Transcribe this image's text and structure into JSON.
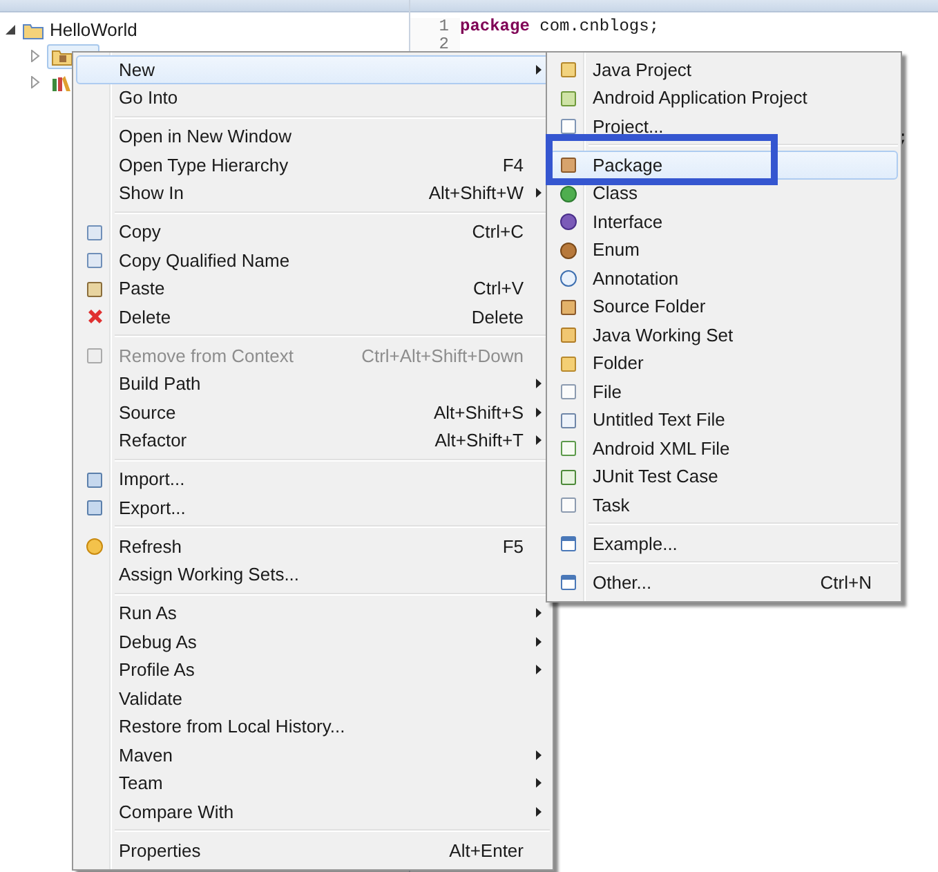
{
  "package_explorer": {
    "tree": [
      {
        "label": "HelloWorld",
        "expanded": true,
        "children": [
          {
            "kind": "package-folder",
            "selected": true
          },
          {
            "kind": "library",
            "selected": false
          }
        ]
      }
    ]
  },
  "editor": {
    "lines": [
      {
        "number": "1",
        "keyword": "package",
        "code": "com.cnblogs;"
      },
      {
        "number": "2"
      }
    ],
    "covered_line_end": ";"
  },
  "context_menu": {
    "items": [
      {
        "kind": "item",
        "label": "New",
        "submenu": true,
        "highlighted": true,
        "disabled": false
      },
      {
        "kind": "item",
        "label": "Go Into",
        "submenu": false,
        "highlighted": false,
        "disabled": false
      },
      {
        "kind": "separator"
      },
      {
        "kind": "item",
        "label": "Open in New Window",
        "submenu": false,
        "highlighted": false,
        "disabled": false
      },
      {
        "kind": "item",
        "label": "Open Type Hierarchy",
        "shortcut": "F4",
        "submenu": false,
        "highlighted": false,
        "disabled": false
      },
      {
        "kind": "item",
        "label": "Show In",
        "shortcut": "Alt+Shift+W",
        "submenu": true,
        "highlighted": false,
        "disabled": false
      },
      {
        "kind": "separator"
      },
      {
        "kind": "item",
        "label": "Copy",
        "shortcut": "Ctrl+C",
        "submenu": false,
        "highlighted": false,
        "disabled": false
      },
      {
        "kind": "item",
        "label": "Copy Qualified Name",
        "submenu": false,
        "highlighted": false,
        "disabled": false
      },
      {
        "kind": "item",
        "label": "Paste",
        "shortcut": "Ctrl+V",
        "submenu": false,
        "highlighted": false,
        "disabled": false
      },
      {
        "kind": "item",
        "label": "Delete",
        "shortcut": "Delete",
        "submenu": false,
        "highlighted": false,
        "disabled": false
      },
      {
        "kind": "separator"
      },
      {
        "kind": "item",
        "label": "Remove from Context",
        "shortcut": "Ctrl+Alt+Shift+Down",
        "submenu": false,
        "highlighted": false,
        "disabled": true
      },
      {
        "kind": "item",
        "label": "Build Path",
        "submenu": true,
        "highlighted": false,
        "disabled": false
      },
      {
        "kind": "item",
        "label": "Source",
        "shortcut": "Alt+Shift+S",
        "submenu": true,
        "highlighted": false,
        "disabled": false
      },
      {
        "kind": "item",
        "label": "Refactor",
        "shortcut": "Alt+Shift+T",
        "submenu": true,
        "highlighted": false,
        "disabled": false
      },
      {
        "kind": "separator"
      },
      {
        "kind": "item",
        "label": "Import...",
        "submenu": false,
        "highlighted": false,
        "disabled": false
      },
      {
        "kind": "item",
        "label": "Export...",
        "submenu": false,
        "highlighted": false,
        "disabled": false
      },
      {
        "kind": "separator"
      },
      {
        "kind": "item",
        "label": "Refresh",
        "shortcut": "F5",
        "submenu": false,
        "highlighted": false,
        "disabled": false
      },
      {
        "kind": "item",
        "label": "Assign Working Sets...",
        "submenu": false,
        "highlighted": false,
        "disabled": false
      },
      {
        "kind": "separator"
      },
      {
        "kind": "item",
        "label": "Run As",
        "submenu": true,
        "highlighted": false,
        "disabled": false
      },
      {
        "kind": "item",
        "label": "Debug As",
        "submenu": true,
        "highlighted": false,
        "disabled": false
      },
      {
        "kind": "item",
        "label": "Profile As",
        "submenu": true,
        "highlighted": false,
        "disabled": false
      },
      {
        "kind": "item",
        "label": "Validate",
        "submenu": false,
        "highlighted": false,
        "disabled": false
      },
      {
        "kind": "item",
        "label": "Restore from Local History...",
        "submenu": false,
        "highlighted": false,
        "disabled": false
      },
      {
        "kind": "item",
        "label": "Maven",
        "submenu": true,
        "highlighted": false,
        "disabled": false
      },
      {
        "kind": "item",
        "label": "Team",
        "submenu": true,
        "highlighted": false,
        "disabled": false
      },
      {
        "kind": "item",
        "label": "Compare With",
        "submenu": true,
        "highlighted": false,
        "disabled": false
      },
      {
        "kind": "separator"
      },
      {
        "kind": "item",
        "label": "Properties",
        "shortcut": "Alt+Enter",
        "submenu": false,
        "highlighted": false,
        "disabled": false
      }
    ]
  },
  "new_submenu": {
    "items": [
      {
        "kind": "item",
        "label": "Java Project",
        "highlighted": false,
        "annotated": false
      },
      {
        "kind": "item",
        "label": "Android Application Project",
        "highlighted": false,
        "annotated": false
      },
      {
        "kind": "item",
        "label": "Project...",
        "highlighted": false,
        "annotated": false
      },
      {
        "kind": "separator"
      },
      {
        "kind": "item",
        "label": "Package",
        "highlighted": true,
        "annotated": true
      },
      {
        "kind": "item",
        "label": "Class",
        "highlighted": false,
        "annotated": false
      },
      {
        "kind": "item",
        "label": "Interface",
        "highlighted": false,
        "annotated": false
      },
      {
        "kind": "item",
        "label": "Enum",
        "highlighted": false,
        "annotated": false
      },
      {
        "kind": "item",
        "label": "Annotation",
        "highlighted": false,
        "annotated": false
      },
      {
        "kind": "item",
        "label": "Source Folder",
        "highlighted": false,
        "annotated": false
      },
      {
        "kind": "item",
        "label": "Java Working Set",
        "highlighted": false,
        "annotated": false
      },
      {
        "kind": "item",
        "label": "Folder",
        "highlighted": false,
        "annotated": false
      },
      {
        "kind": "item",
        "label": "File",
        "highlighted": false,
        "annotated": false
      },
      {
        "kind": "item",
        "label": "Untitled Text File",
        "highlighted": false,
        "annotated": false
      },
      {
        "kind": "item",
        "label": "Android XML File",
        "highlighted": false,
        "annotated": false
      },
      {
        "kind": "item",
        "label": "JUnit Test Case",
        "highlighted": false,
        "annotated": false
      },
      {
        "kind": "item",
        "label": "Task",
        "highlighted": false,
        "annotated": false
      },
      {
        "kind": "separator"
      },
      {
        "kind": "item",
        "label": "Example...",
        "highlighted": false,
        "annotated": false
      },
      {
        "kind": "separator"
      },
      {
        "kind": "item",
        "label": "Other...",
        "shortcut": "Ctrl+N",
        "highlighted": false,
        "annotated": false
      }
    ]
  }
}
